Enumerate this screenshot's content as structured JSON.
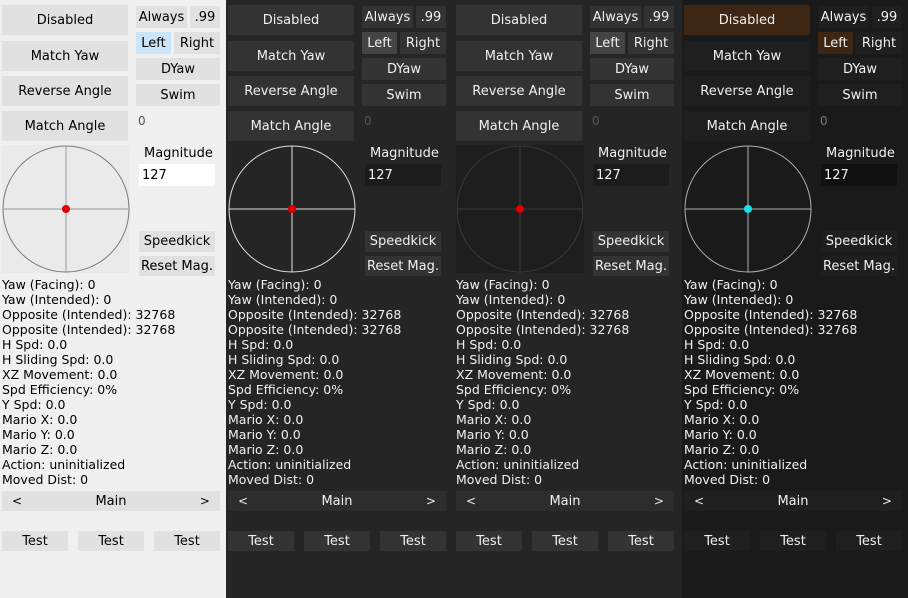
{
  "panels": [
    {
      "theme": "light",
      "dot_color": "#e00000",
      "buttons": {
        "mode": "Disabled",
        "match_yaw": "Match Yaw",
        "reverse_angle": "Reverse Angle",
        "match_angle": "Match Angle",
        "always": "Always",
        "dot99": ".99",
        "left": "Left",
        "right": "Right",
        "dyaw": "DYaw",
        "swim": "Swim",
        "speedkick": "Speedkick",
        "reset_mag": "Reset Mag."
      },
      "angle_value": "0",
      "magnitude_label": "Magnitude",
      "magnitude_value": "127",
      "stats": [
        "Yaw (Facing): 0",
        "Yaw (Intended): 0",
        "Opposite (Intended): 32768",
        "Opposite (Intended): 32768",
        "H Spd: 0.0",
        "H Sliding Spd: 0.0",
        "XZ Movement: 0.0",
        "Spd Efficiency: 0%",
        "Y Spd: 0.0",
        "Mario X: 0.0",
        "Mario Y: 0.0",
        "Mario Z: 0.0",
        "Action: uninitialized",
        "Moved Dist: 0"
      ],
      "nav": {
        "prev": "<",
        "label": "Main",
        "next": ">"
      },
      "tests": [
        "Test",
        "Test",
        "Test"
      ]
    },
    {
      "theme": "dark",
      "dot_color": "#e00000",
      "buttons": {
        "mode": "Disabled",
        "match_yaw": "Match Yaw",
        "reverse_angle": "Reverse Angle",
        "match_angle": "Match Angle",
        "always": "Always",
        "dot99": ".99",
        "left": "Left",
        "right": "Right",
        "dyaw": "DYaw",
        "swim": "Swim",
        "speedkick": "Speedkick",
        "reset_mag": "Reset Mag."
      },
      "angle_value": "0",
      "magnitude_label": "Magnitude",
      "magnitude_value": "127",
      "stats": [
        "Yaw (Facing): 0",
        "Yaw (Intended): 0",
        "Opposite (Intended): 32768",
        "Opposite (Intended): 32768",
        "H Spd: 0.0",
        "H Sliding Spd: 0.0",
        "XZ Movement: 0.0",
        "Spd Efficiency: 0%",
        "Y Spd: 0.0",
        "Mario X: 0.0",
        "Mario Y: 0.0",
        "Mario Z: 0.0",
        "Action: uninitialized",
        "Moved Dist: 0"
      ],
      "nav": {
        "prev": "<",
        "label": "Main",
        "next": ">"
      },
      "tests": [
        "Test",
        "Test",
        "Test"
      ]
    },
    {
      "theme": "dark-dim",
      "dot_color": "#e00000",
      "buttons": {
        "mode": "Disabled",
        "match_yaw": "Match Yaw",
        "reverse_angle": "Reverse Angle",
        "match_angle": "Match Angle",
        "always": "Always",
        "dot99": ".99",
        "left": "Left",
        "right": "Right",
        "dyaw": "DYaw",
        "swim": "Swim",
        "speedkick": "Speedkick",
        "reset_mag": "Reset Mag."
      },
      "angle_value": "0",
      "magnitude_label": "Magnitude",
      "magnitude_value": "127",
      "stats": [
        "Yaw (Facing): 0",
        "Yaw (Intended): 0",
        "Opposite (Intended): 32768",
        "Opposite (Intended): 32768",
        "H Spd: 0.0",
        "H Sliding Spd: 0.0",
        "XZ Movement: 0.0",
        "Spd Efficiency: 0%",
        "Y Spd: 0.0",
        "Mario X: 0.0",
        "Mario Y: 0.0",
        "Mario Z: 0.0",
        "Action: uninitialized",
        "Moved Dist: 0"
      ],
      "nav": {
        "prev": "<",
        "label": "Main",
        "next": ">"
      },
      "tests": [
        "Test",
        "Test",
        "Test"
      ]
    },
    {
      "theme": "dark-orange",
      "dot_color": "#19e0e8",
      "buttons": {
        "mode": "Disabled",
        "match_yaw": "Match Yaw",
        "reverse_angle": "Reverse Angle",
        "match_angle": "Match Angle",
        "always": "Always",
        "dot99": ".99",
        "left": "Left",
        "right": "Right",
        "dyaw": "DYaw",
        "swim": "Swim",
        "speedkick": "Speedkick",
        "reset_mag": "Reset Mag."
      },
      "angle_value": "0",
      "magnitude_label": "Magnitude",
      "magnitude_value": "127",
      "stats": [
        "Yaw (Facing): 0",
        "Yaw (Intended): 0",
        "Opposite (Intended): 32768",
        "Opposite (Intended): 32768",
        "H Spd: 0.0",
        "H Sliding Spd: 0.0",
        "XZ Movement: 0.0",
        "Spd Efficiency: 0%",
        "Y Spd: 0.0",
        "Mario X: 0.0",
        "Mario Y: 0.0",
        "Mario Z: 0.0",
        "Action: uninitialized",
        "Moved Dist: 0"
      ],
      "nav": {
        "prev": "<",
        "label": "Main",
        "next": ">"
      },
      "tests": [
        "Test",
        "Test",
        "Test"
      ]
    }
  ]
}
